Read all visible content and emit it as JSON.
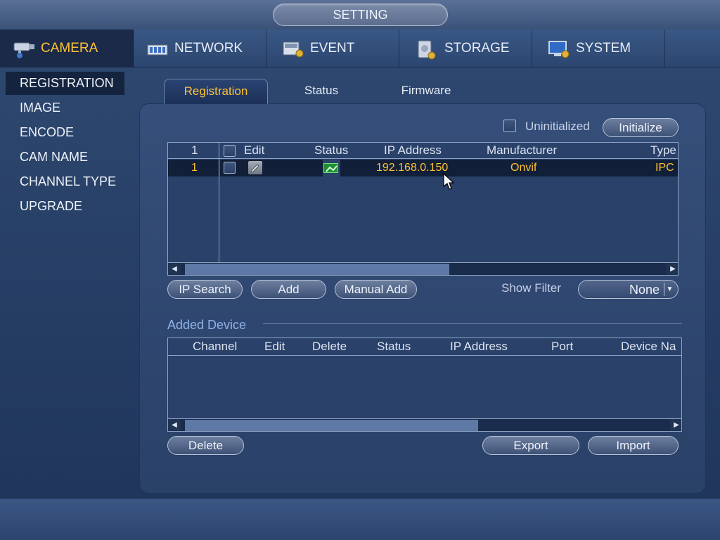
{
  "window": {
    "title": "SETTING"
  },
  "main_tabs": [
    {
      "label": "CAMERA",
      "icon": "camera-icon",
      "active": true
    },
    {
      "label": "NETWORK",
      "icon": "network-icon"
    },
    {
      "label": "EVENT",
      "icon": "event-icon"
    },
    {
      "label": "STORAGE",
      "icon": "storage-icon"
    },
    {
      "label": "SYSTEM",
      "icon": "system-icon"
    }
  ],
  "sidebar": {
    "items": [
      {
        "label": "REGISTRATION",
        "active": true
      },
      {
        "label": "IMAGE"
      },
      {
        "label": "ENCODE"
      },
      {
        "label": "CAM NAME"
      },
      {
        "label": "CHANNEL TYPE"
      },
      {
        "label": "UPGRADE"
      }
    ]
  },
  "sub_tabs": [
    {
      "label": "Registration",
      "active": true
    },
    {
      "label": "Status"
    },
    {
      "label": "Firmware"
    }
  ],
  "registration": {
    "uninitialized_label": "Uninitialized",
    "initialize_button": "Initialize",
    "search_table": {
      "headers": [
        "1",
        "Edit",
        "Status",
        "IP Address",
        "Manufacturer",
        "Type"
      ],
      "rows": [
        {
          "index": "1",
          "status_icon": "connected-icon",
          "ip": "192.168.0.150",
          "manufacturer": "Onvif",
          "type": "IPC"
        }
      ]
    },
    "buttons": {
      "ip_search": "IP Search",
      "add": "Add",
      "manual_add": "Manual Add"
    },
    "show_filter": {
      "label": "Show Filter",
      "value": "None"
    },
    "added_device": {
      "title": "Added Device",
      "headers": [
        "Channel",
        "Edit",
        "Delete",
        "Status",
        "IP Address",
        "Port",
        "Device Na"
      ]
    },
    "bottom_buttons": {
      "delete": "Delete",
      "export": "Export",
      "import": "Import"
    }
  },
  "colors": {
    "accent": "#ffc233",
    "panel": "#2e4670",
    "status_ok": "#2aa83a"
  }
}
